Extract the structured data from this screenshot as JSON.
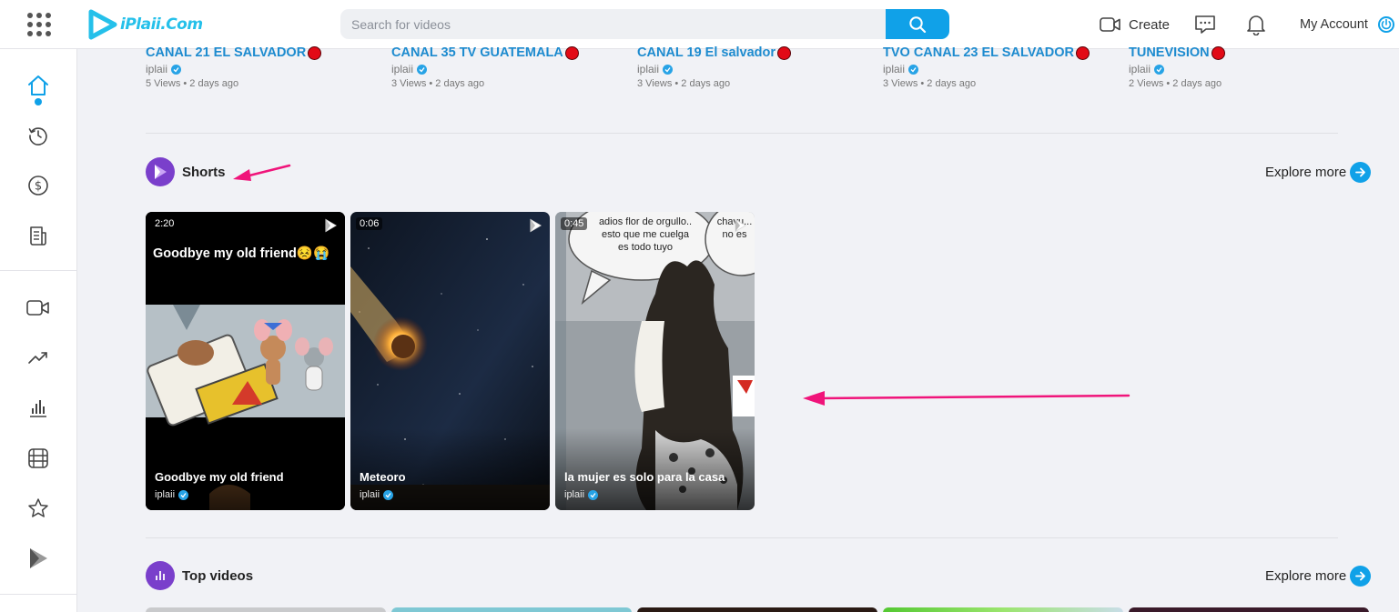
{
  "header": {
    "logo_text": "iPlaii.Com",
    "search_placeholder": "Search for videos",
    "create_label": "Create",
    "account_label": "My Account"
  },
  "channels": [
    {
      "title": "CANAL 21 EL SALVADOR",
      "author": "iplaii",
      "meta": "5 Views • 2 days ago"
    },
    {
      "title": "CANAL 35 TV GUATEMALA",
      "author": "iplaii",
      "meta": "3 Views • 2 days ago"
    },
    {
      "title": "CANAL 19 El salvador",
      "author": "iplaii",
      "meta": "3 Views • 2 days ago"
    },
    {
      "title": "TVO CANAL 23 EL SALVADOR",
      "author": "iplaii",
      "meta": "3 Views • 2 days ago"
    },
    {
      "title": "TUNEVISION",
      "author": "iplaii",
      "meta": "2 Views • 2 days ago"
    }
  ],
  "shorts_section": {
    "title": "Shorts",
    "explore_label": "Explore more",
    "items": [
      {
        "duration": "2:20",
        "title": "Goodbye my old friend",
        "author": "iplaii",
        "overlay_text": "Goodbye my old friend😣😭"
      },
      {
        "duration": "0:06",
        "title": "Meteoro",
        "author": "iplaii"
      },
      {
        "duration": "0:45",
        "title": "la mujer es solo para la casa",
        "author": "iplaii",
        "bubble_left": "adios flor de orgullo.. esto que me cuelga es todo tuyo",
        "bubble_right": "chavu... no es"
      }
    ]
  },
  "top_videos_section": {
    "title": "Top videos",
    "explore_label": "Explore more"
  },
  "colors": {
    "accent": "#10a1e8",
    "channel_link": "#1d8bcf",
    "live": "#e20a16",
    "section_icon": "#7a3fcb",
    "annotation_arrow": "#f0147a"
  }
}
